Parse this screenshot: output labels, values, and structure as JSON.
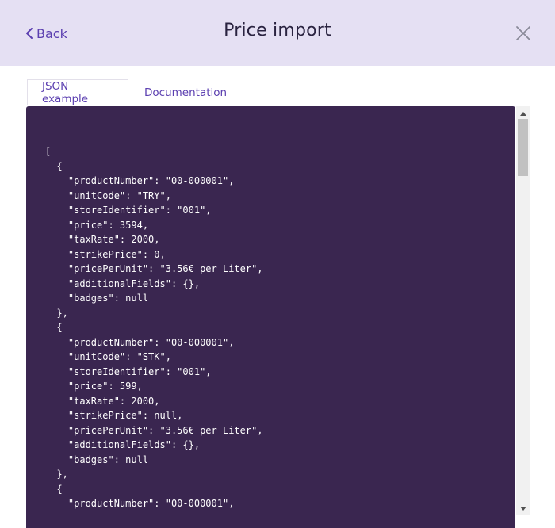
{
  "header": {
    "back_label": "Back",
    "title": "Price import",
    "close_icon": "close-icon",
    "back_icon": "chevron-left-icon",
    "background": "#e5e0f3",
    "accent": "#5b3fb0"
  },
  "tabs": [
    {
      "label": "JSON example",
      "active": true
    },
    {
      "label": "Documentation",
      "active": false
    }
  ],
  "code": {
    "background": "#3a2650",
    "text": "[\n  {\n    \"productNumber\": \"00-000001\",\n    \"unitCode\": \"TRY\",\n    \"storeIdentifier\": \"001\",\n    \"price\": 3594,\n    \"taxRate\": 2000,\n    \"strikePrice\": 0,\n    \"pricePerUnit\": \"3.56€ per Liter\",\n    \"additionalFields\": {},\n    \"badges\": null\n  },\n  {\n    \"productNumber\": \"00-000001\",\n    \"unitCode\": \"STK\",\n    \"storeIdentifier\": \"001\",\n    \"price\": 599,\n    \"taxRate\": 2000,\n    \"strikePrice\": null,\n    \"pricePerUnit\": \"3.56€ per Liter\",\n    \"additionalFields\": {},\n    \"badges\": null\n  },\n  {\n    \"productNumber\": \"00-000001\","
  }
}
